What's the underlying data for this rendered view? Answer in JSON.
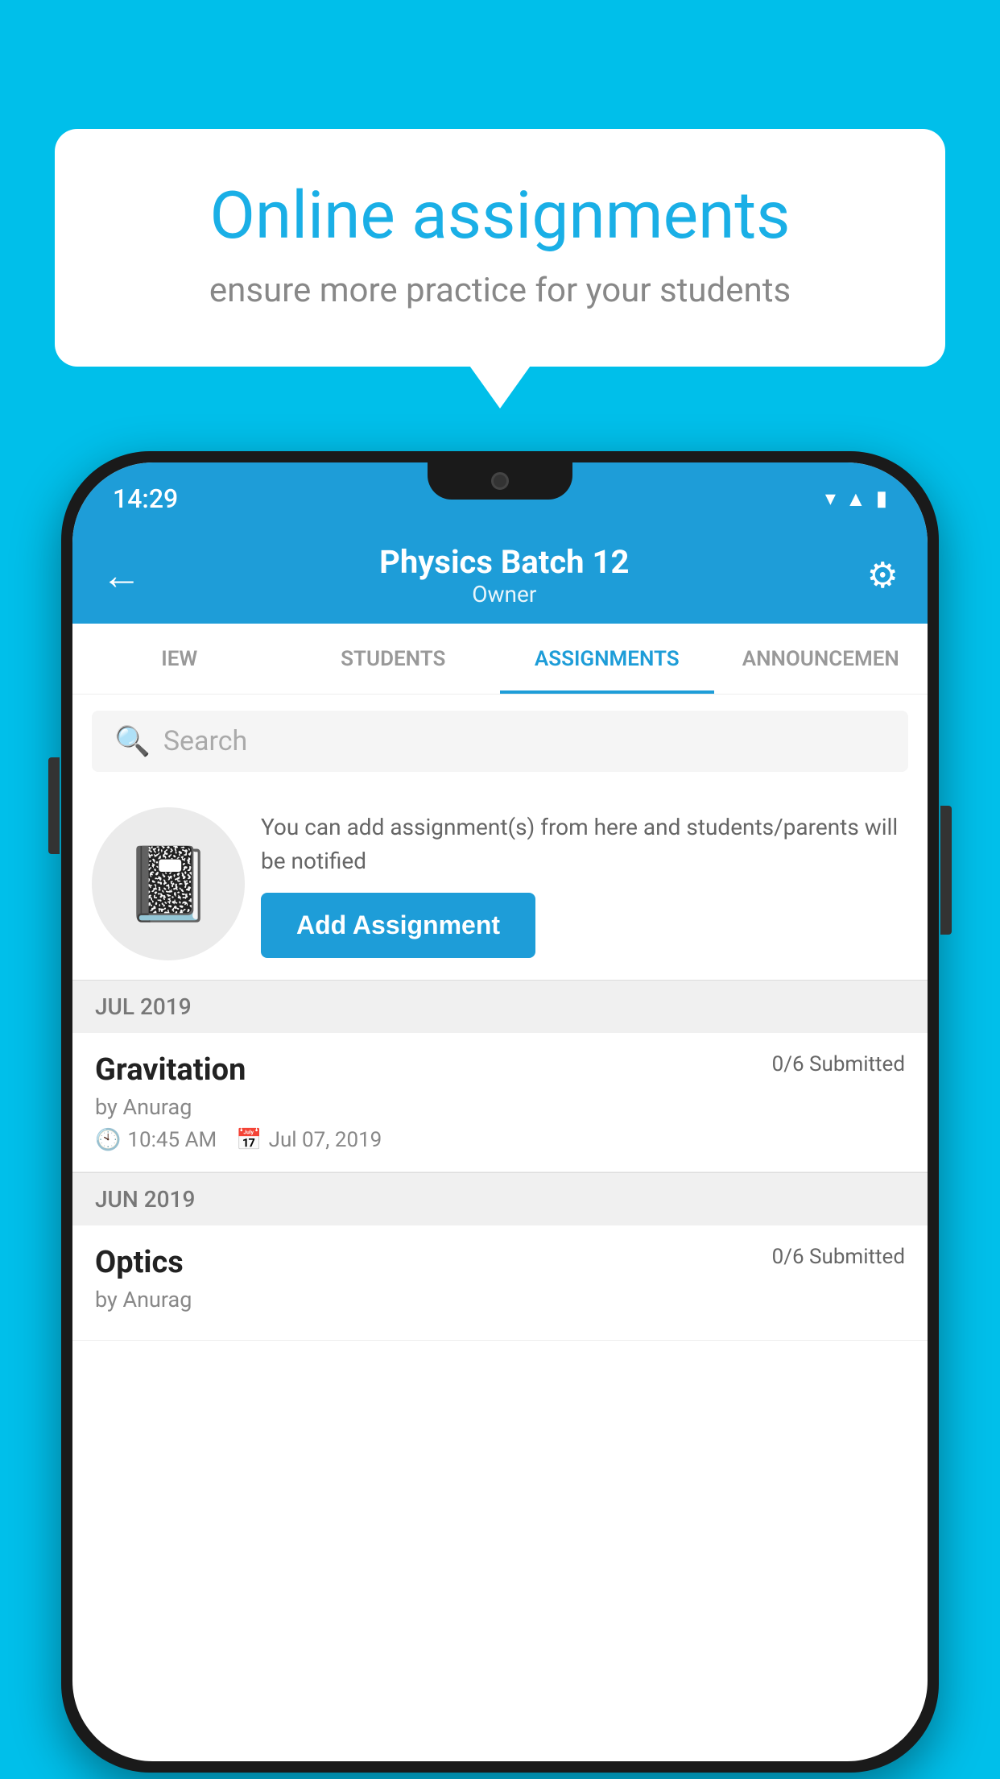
{
  "background": {
    "color": "#00BFEA"
  },
  "speech_bubble": {
    "title": "Online assignments",
    "subtitle": "ensure more practice for your students"
  },
  "phone": {
    "status_bar": {
      "time": "14:29",
      "icons": [
        "wifi",
        "signal",
        "battery"
      ]
    },
    "app_bar": {
      "title": "Physics Batch 12",
      "subtitle": "Owner",
      "back_icon": "←",
      "settings_icon": "⚙"
    },
    "tabs": [
      {
        "label": "IEW",
        "active": false
      },
      {
        "label": "STUDENTS",
        "active": false
      },
      {
        "label": "ASSIGNMENTS",
        "active": true
      },
      {
        "label": "ANNOUNCEMENTS",
        "active": false
      }
    ],
    "search": {
      "placeholder": "Search"
    },
    "promo": {
      "description": "You can add assignment(s) from here and students/parents will be notified",
      "button_label": "Add Assignment"
    },
    "month_groups": [
      {
        "month": "JUL 2019",
        "assignments": [
          {
            "name": "Gravitation",
            "status": "0/6 Submitted",
            "author": "by Anurag",
            "time": "10:45 AM",
            "date": "Jul 07, 2019"
          }
        ]
      },
      {
        "month": "JUN 2019",
        "assignments": [
          {
            "name": "Optics",
            "status": "0/6 Submitted",
            "author": "by Anurag",
            "time": "",
            "date": ""
          }
        ]
      }
    ]
  }
}
